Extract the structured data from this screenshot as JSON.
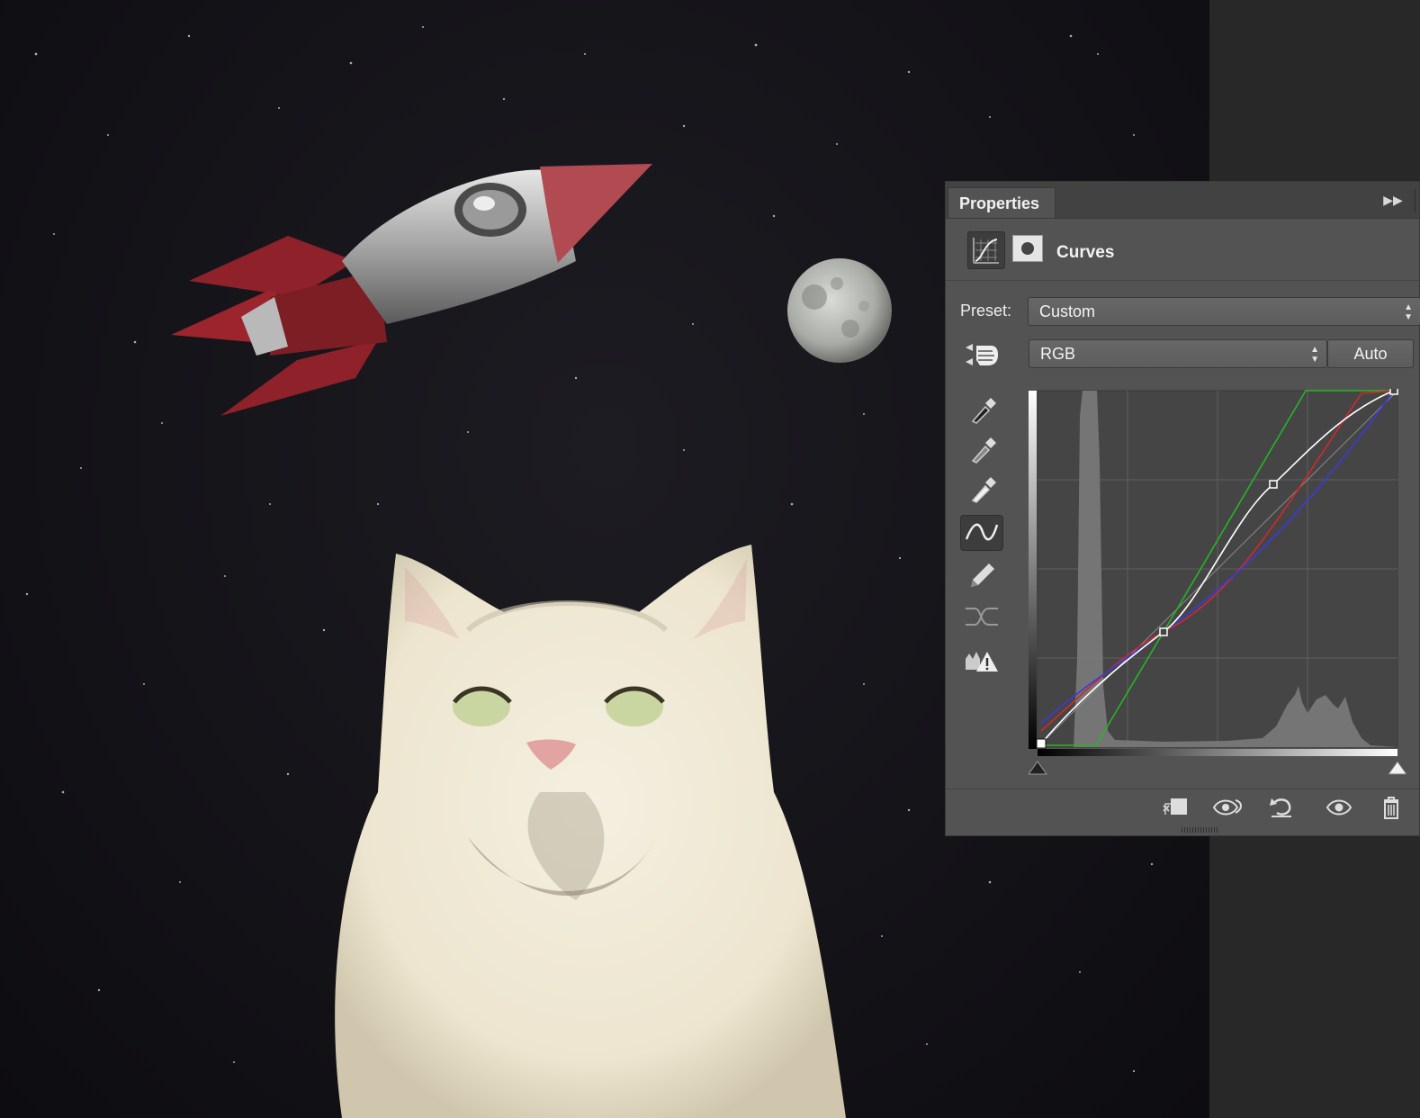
{
  "panel": {
    "tab_label": "Properties",
    "adjustment_title": "Curves",
    "preset_label": "Preset:",
    "preset_value": "Custom",
    "channel_value": "RGB",
    "auto_label": "Auto"
  },
  "tools": [
    {
      "name": "on-image-adjust-icon"
    },
    {
      "name": "black-point-eyedropper-icon"
    },
    {
      "name": "gray-point-eyedropper-icon"
    },
    {
      "name": "white-point-eyedropper-icon"
    },
    {
      "name": "edit-points-curve-icon"
    },
    {
      "name": "draw-curve-pencil-icon"
    },
    {
      "name": "smooth-curve-icon"
    },
    {
      "name": "clipping-warning-icon"
    }
  ],
  "footer_icons": [
    "clip-to-layer-icon",
    "view-previous-state-icon",
    "reset-icon",
    "toggle-visibility-icon",
    "delete-icon"
  ],
  "colors": {
    "panel_bg": "#535353",
    "curve_rgb": "#ffffff",
    "curve_red": "#d02a2a",
    "curve_green": "#26b526",
    "curve_blue": "#3a3ae0"
  }
}
